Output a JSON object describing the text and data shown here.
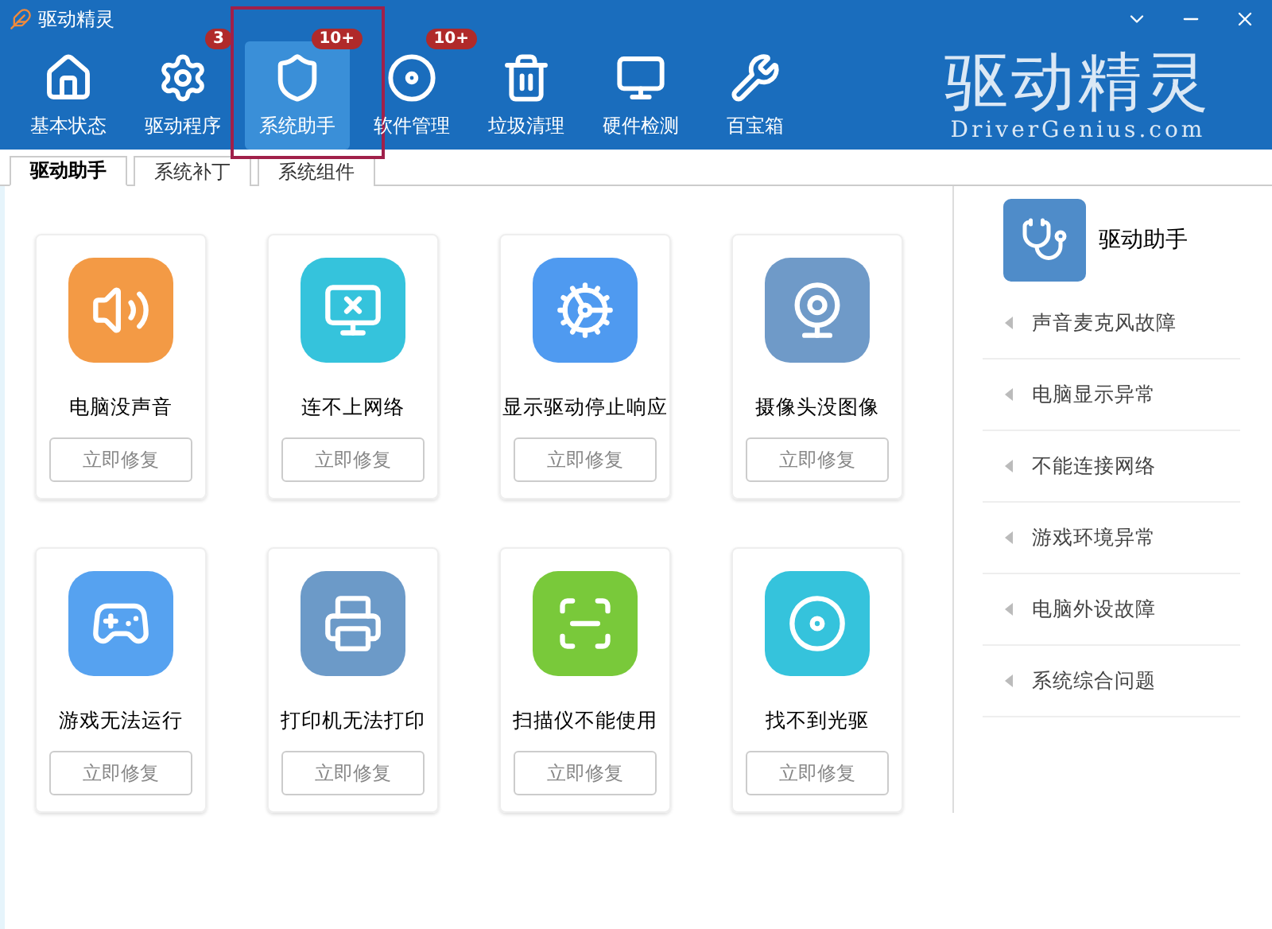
{
  "window": {
    "title": "驱动精灵"
  },
  "nav": [
    {
      "label": "基本状态",
      "selected": false
    },
    {
      "label": "驱动程序",
      "badge": "3",
      "selected": false
    },
    {
      "label": "系统助手",
      "badge": "10+",
      "selected": true,
      "highlighted": true
    },
    {
      "label": "软件管理",
      "badge": "10+",
      "selected": false
    },
    {
      "label": "垃圾清理",
      "selected": false
    },
    {
      "label": "硬件检测",
      "selected": false
    },
    {
      "label": "百宝箱",
      "selected": false
    }
  ],
  "logo": {
    "title": "驱动精灵",
    "site": "DriverGenius.com"
  },
  "tabs": [
    {
      "label": "驱动助手",
      "selected": true
    },
    {
      "label": "系统补丁",
      "selected": false
    },
    {
      "label": "系统组件",
      "selected": false
    }
  ],
  "cards": [
    {
      "title": "电脑没声音",
      "color": "#f39a45",
      "button": "立即修复"
    },
    {
      "title": "连不上网络",
      "color": "#35c3dc",
      "button": "立即修复"
    },
    {
      "title": "显示驱动停止响应",
      "color": "#4f9af0",
      "button": "立即修复"
    },
    {
      "title": "摄像头没图像",
      "color": "#6f9ac8",
      "button": "立即修复"
    },
    {
      "title": "游戏无法运行",
      "color": "#56a2f0",
      "button": "立即修复"
    },
    {
      "title": "打印机无法打印",
      "color": "#6c9ac8",
      "button": "立即修复"
    },
    {
      "title": "扫描仪不能使用",
      "color": "#79c93a",
      "button": "立即修复"
    },
    {
      "title": "找不到光驱",
      "color": "#35c3dc",
      "button": "立即修复"
    }
  ],
  "side": {
    "title": "驱动助手",
    "items": [
      "声音麦克风故障",
      "电脑显示异常",
      "不能连接网络",
      "游戏环境异常",
      "电脑外设故障",
      "系统综合问题"
    ]
  }
}
